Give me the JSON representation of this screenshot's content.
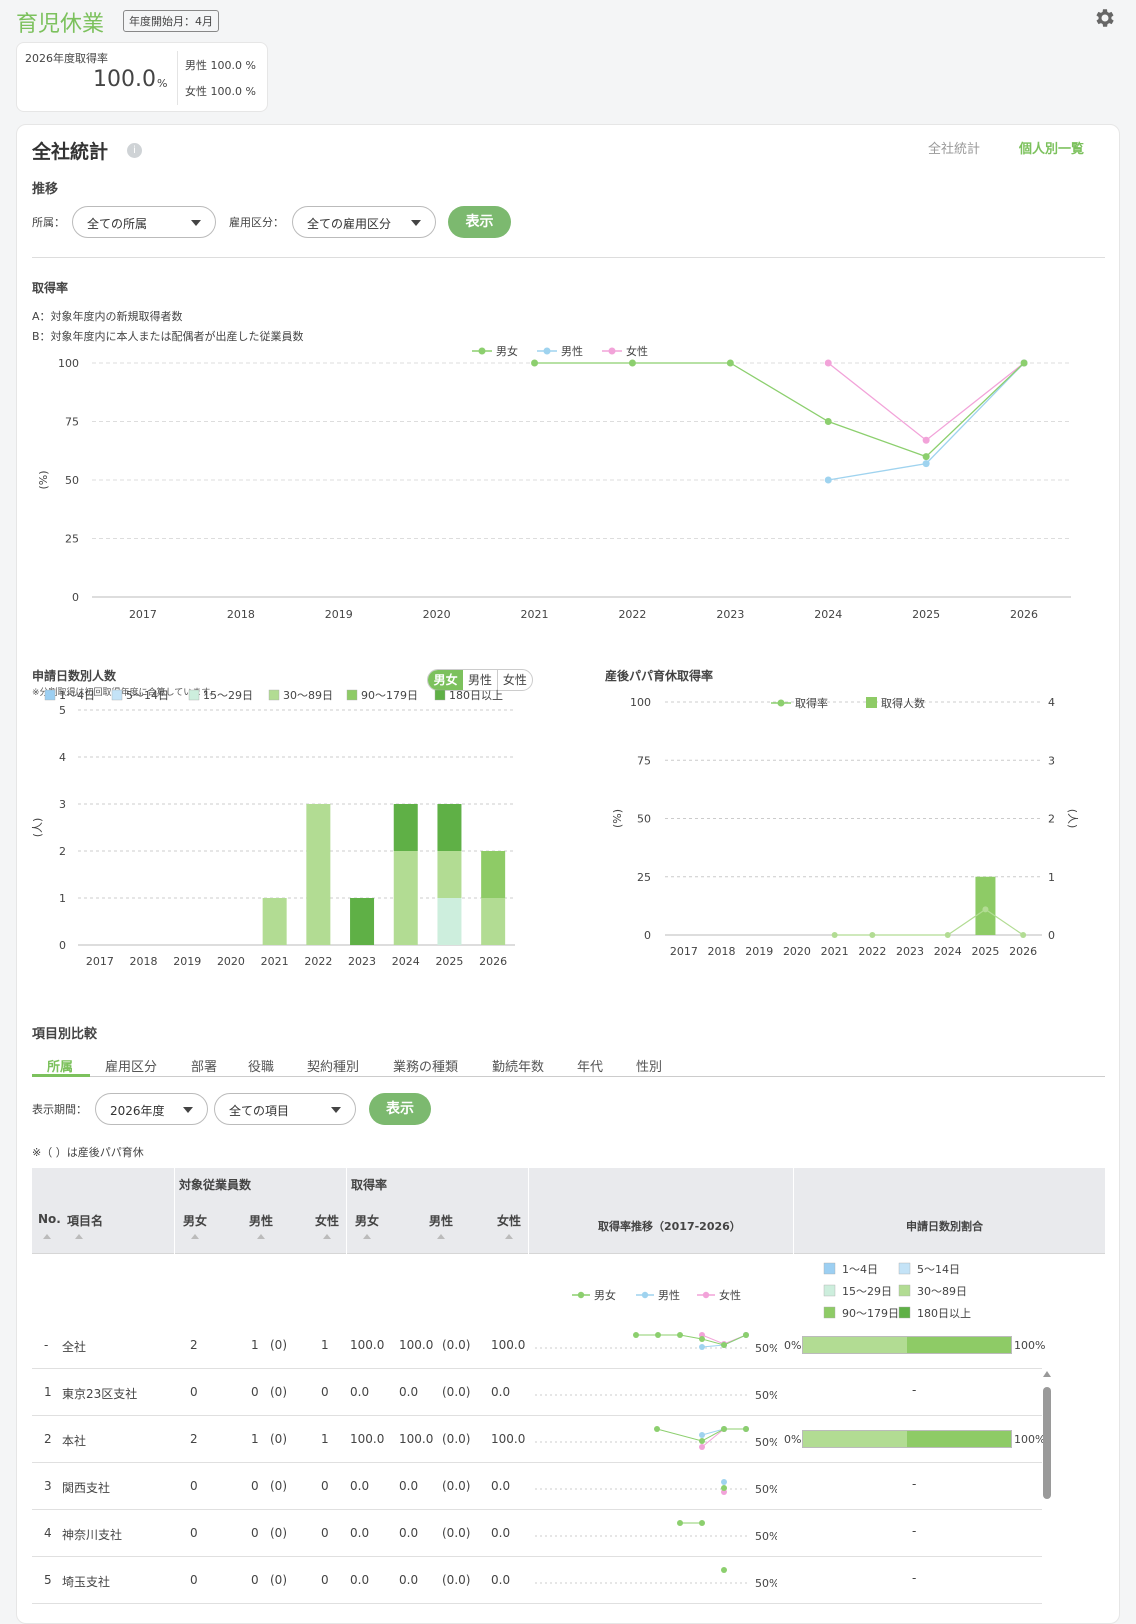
{
  "header": {
    "title": "育児休業",
    "badge": "年度開始月：4月"
  },
  "summary": {
    "label": "2026年度取得率",
    "value": "100.0",
    "unit": "%",
    "male": "男性 100.0 %",
    "female": "女性 100.0 %"
  },
  "main": {
    "title": "全社統計",
    "view_tabs": [
      "全社統計",
      "個人別一覧"
    ],
    "trend": {
      "title": "推移",
      "dept_label": "所属：",
      "dept_value": "全ての所属",
      "emp_label": "雇用区分：",
      "emp_value": "全ての雇用区分",
      "show_label": "表示"
    }
  },
  "rate": {
    "title": "取得率",
    "note_a": "A：対象年度内の新規取得者数",
    "note_b": "B：対象年度内に本人または配偶者が出産した従業員数"
  },
  "days": {
    "title": "申請日数別人数",
    "note": "※分割取得は初回取得年度に合算しています。",
    "toggle": [
      "男女",
      "男性",
      "女性"
    ]
  },
  "papa": {
    "title": "産後パパ育休取得率"
  },
  "compare": {
    "title": "項目別比較",
    "tabs": [
      "所属",
      "雇用区分",
      "部署",
      "役職",
      "契約種別",
      "業務の種類",
      "勤続年数",
      "年代",
      "性別"
    ],
    "period_label": "表示期間：",
    "period_value": "2026年度",
    "item_value": "全ての項目",
    "show_label": "表示",
    "note": "※（ ）は産後パパ育休"
  },
  "table": {
    "h_no": "No.",
    "h_name": "項目名",
    "h_target": "対象従業員数",
    "h_rate": "取得率",
    "h_all": "男女",
    "h_male": "男性",
    "h_female": "女性",
    "h_trend": "取得率推移（2017-2026）",
    "h_ratio": "申請日数別割合",
    "trend_50": "50%",
    "bar_0": "0%",
    "bar_100": "100%",
    "dash": "-",
    "rows": [
      {
        "no": "-",
        "name": "全社",
        "t_all": "2",
        "t_male": "1",
        "t_male_p": "(0)",
        "t_female": "1",
        "r_all": "100.0",
        "r_male": "100.0",
        "r_male_p": "(0.0)",
        "r_female": "100.0",
        "bar": [
          0.5,
          0.5
        ]
      },
      {
        "no": "1",
        "name": "東京23区支社",
        "t_all": "0",
        "t_male": "0",
        "t_male_p": "(0)",
        "t_female": "0",
        "r_all": "0.0",
        "r_male": "0.0",
        "r_male_p": "(0.0)",
        "r_female": "0.0",
        "bar": null
      },
      {
        "no": "2",
        "name": "本社",
        "t_all": "2",
        "t_male": "1",
        "t_male_p": "(0)",
        "t_female": "1",
        "r_all": "100.0",
        "r_male": "100.0",
        "r_male_p": "(0.0)",
        "r_female": "100.0",
        "bar": [
          0.5,
          0.5
        ]
      },
      {
        "no": "3",
        "name": "関西支社",
        "t_all": "0",
        "t_male": "0",
        "t_male_p": "(0)",
        "t_female": "0",
        "r_all": "0.0",
        "r_male": "0.0",
        "r_male_p": "(0.0)",
        "r_female": "0.0",
        "bar": null
      },
      {
        "no": "4",
        "name": "神奈川支社",
        "t_all": "0",
        "t_male": "0",
        "t_male_p": "(0)",
        "t_female": "0",
        "r_all": "0.0",
        "r_male": "0.0",
        "r_male_p": "(0.0)",
        "r_female": "0.0",
        "bar": null
      },
      {
        "no": "5",
        "name": "埼玉支社",
        "t_all": "0",
        "t_male": "0",
        "t_male_p": "(0)",
        "t_female": "0",
        "r_all": "0.0",
        "r_male": "0.0",
        "r_male_p": "(0.0)",
        "r_female": "0.0",
        "bar": null
      }
    ]
  },
  "colors": {
    "all": "#8ccf6e",
    "male": "#9fd3ef",
    "female": "#f2a3d9",
    "d1": "#9ccff2",
    "d2": "#c4e3f7",
    "d3": "#cdeedd",
    "d4": "#b2dc93",
    "d5": "#8ecb66",
    "d6": "#5fb046"
  },
  "chart_data": [
    {
      "type": "line",
      "ylabel": "(%)",
      "ylim": [
        0,
        100
      ],
      "yticks": [
        0,
        25,
        50,
        75,
        100
      ],
      "grid": true,
      "legend": "top-center",
      "x": [
        "2017",
        "2018",
        "2019",
        "2020",
        "2021",
        "2022",
        "2023",
        "2024",
        "2025",
        "2026"
      ],
      "series": [
        {
          "name": "男女",
          "values": [
            null,
            null,
            null,
            null,
            100,
            100,
            100,
            75,
            60,
            100
          ]
        },
        {
          "name": "男性",
          "values": [
            null,
            null,
            null,
            null,
            null,
            null,
            null,
            50,
            57,
            100
          ]
        },
        {
          "name": "女性",
          "values": [
            null,
            null,
            null,
            null,
            null,
            null,
            null,
            100,
            67,
            100
          ]
        }
      ]
    },
    {
      "type": "bar",
      "stacked": true,
      "ylabel": "(人)",
      "ylim": [
        0,
        5
      ],
      "yticks": [
        0,
        1,
        2,
        3,
        4,
        5
      ],
      "legend": "top",
      "categories": [
        "2017",
        "2018",
        "2019",
        "2020",
        "2021",
        "2022",
        "2023",
        "2024",
        "2025",
        "2026"
      ],
      "series": [
        {
          "name": "1〜4日",
          "values": [
            0,
            0,
            0,
            0,
            0,
            0,
            0,
            0,
            0,
            0
          ]
        },
        {
          "name": "5〜14日",
          "values": [
            0,
            0,
            0,
            0,
            0,
            0,
            0,
            0,
            0,
            0
          ]
        },
        {
          "name": "15〜29日",
          "values": [
            0,
            0,
            0,
            0,
            0,
            0,
            0,
            0,
            1,
            0
          ]
        },
        {
          "name": "30〜89日",
          "values": [
            0,
            0,
            0,
            0,
            1,
            3,
            0,
            2,
            1,
            1
          ]
        },
        {
          "name": "90〜179日",
          "values": [
            0,
            0,
            0,
            0,
            0,
            0,
            0,
            0,
            0,
            1
          ]
        },
        {
          "name": "180日以上",
          "values": [
            0,
            0,
            0,
            0,
            0,
            0,
            1,
            1,
            1,
            0
          ]
        }
      ]
    },
    {
      "type": "bar",
      "ylabel": "(%)",
      "ylabel_right": "(人)",
      "ylim": [
        0,
        100
      ],
      "ylim_right": [
        0,
        4
      ],
      "yticks": [
        0,
        25,
        50,
        75,
        100
      ],
      "yticks_right": [
        0,
        1,
        2,
        3,
        4
      ],
      "legend": "top-center",
      "categories": [
        "2017",
        "2018",
        "2019",
        "2020",
        "2021",
        "2022",
        "2023",
        "2024",
        "2025",
        "2026"
      ],
      "series": [
        {
          "name": "取得率",
          "kind": "line",
          "values": [
            null,
            null,
            null,
            null,
            0,
            0,
            null,
            0,
            11,
            0
          ]
        },
        {
          "name": "取得人数",
          "kind": "bar",
          "values": [
            0,
            0,
            0,
            0,
            0,
            0,
            0,
            0,
            1,
            0
          ]
        }
      ]
    }
  ]
}
